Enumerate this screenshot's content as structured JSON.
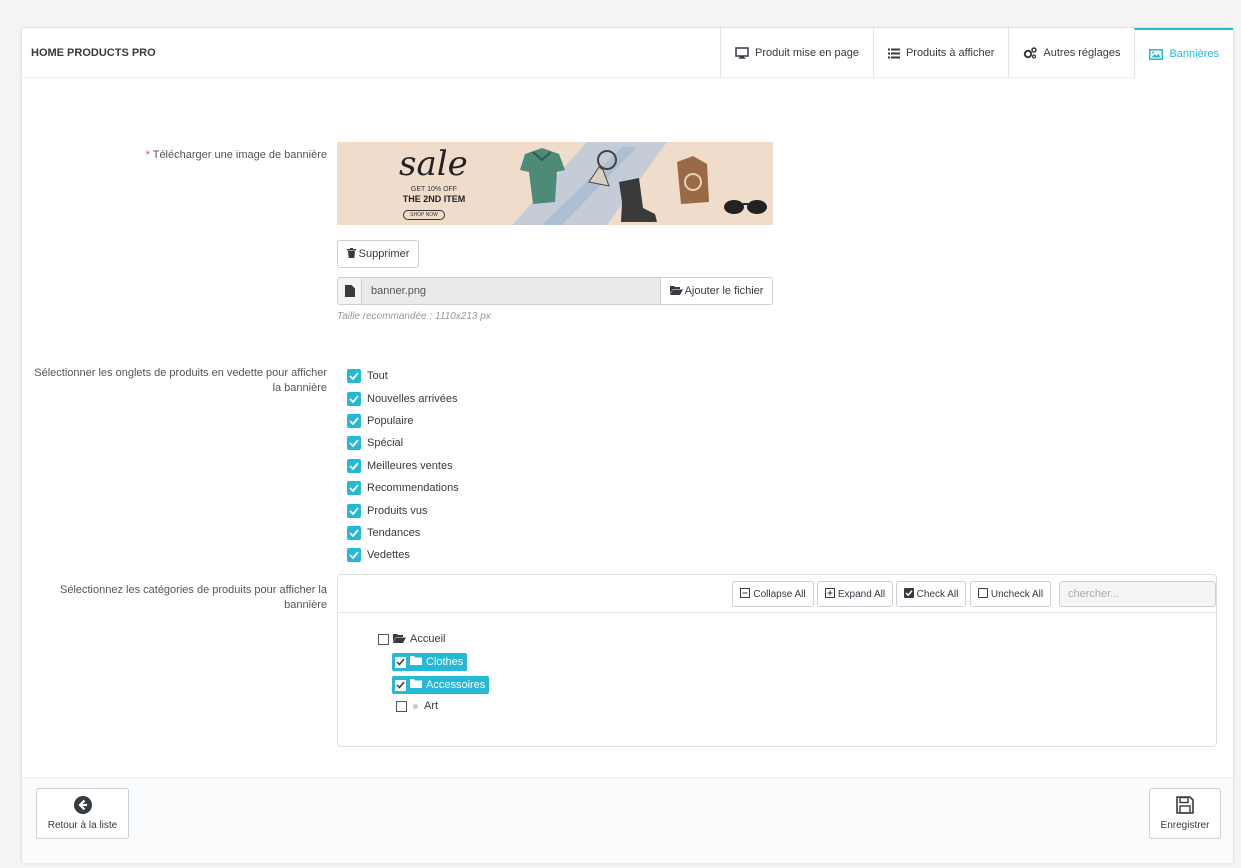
{
  "header": {
    "title": "HOME PRODUCTS PRO",
    "tabs": [
      {
        "label": "Produit mise en page",
        "icon": "monitor-icon"
      },
      {
        "label": "Produits à afficher",
        "icon": "list-icon"
      },
      {
        "label": "Autres réglages",
        "icon": "gears-icon"
      },
      {
        "label": "Bannières",
        "icon": "image-icon",
        "active": true
      }
    ]
  },
  "banner_section": {
    "required_mark": "*",
    "label": "Télécharger une image de bannière",
    "banner_image": {
      "headline": "sale",
      "line1": "GET 10% OFF",
      "line2": "THE 2ND ITEM",
      "cta": "SHOP NOW"
    },
    "delete_label": "Supprimer",
    "file_name": "banner.png",
    "add_file_label": "Ajouter le fichier",
    "hint": "Taille recommandée : 1110x213 px"
  },
  "tabs_section": {
    "label": "Sélectionner les onglets de produits en vedette pour afficher la bannière",
    "items": [
      {
        "label": "Tout",
        "checked": true
      },
      {
        "label": "Nouvelles arrivées",
        "checked": true
      },
      {
        "label": "Populaire",
        "checked": true
      },
      {
        "label": "Spécial",
        "checked": true
      },
      {
        "label": "Meilleures ventes",
        "checked": true
      },
      {
        "label": "Recommendations",
        "checked": true
      },
      {
        "label": "Produits vus",
        "checked": true
      },
      {
        "label": "Tendances",
        "checked": true
      },
      {
        "label": "Vedettes",
        "checked": true
      }
    ]
  },
  "categories_section": {
    "label": "Sélectionnez les catégories de produits pour afficher la bannière",
    "toolbar": {
      "collapse": "Collapse All",
      "expand": "Expand All",
      "check": "Check All",
      "uncheck": "Uncheck All",
      "search_placeholder": "chercher..."
    },
    "tree": {
      "root": {
        "label": "Accueil",
        "checked": false
      },
      "children": [
        {
          "label": "Clothes",
          "checked": true
        },
        {
          "label": "Accessoires",
          "checked": true
        },
        {
          "label": "Art",
          "checked": false
        }
      ]
    }
  },
  "footer": {
    "back_label": "Retour à la liste",
    "save_label": "Enregistrer"
  },
  "colors": {
    "accent": "#25b9d7",
    "required": "#e84e4e"
  }
}
